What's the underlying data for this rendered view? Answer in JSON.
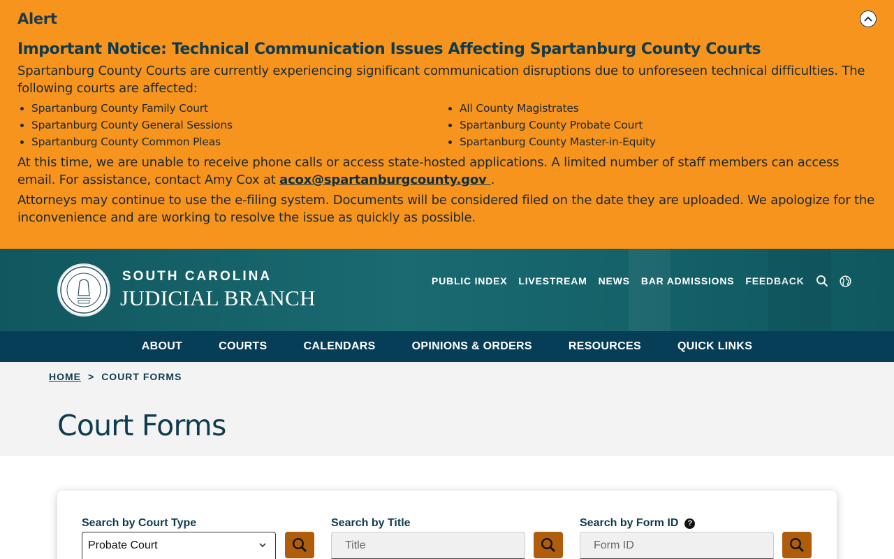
{
  "alert": {
    "title": "Alert",
    "heading": "Important Notice: Technical Communication Issues Affecting Spartanburg County Courts",
    "intro": "Spartanburg County Courts are currently experiencing significant communication disruptions due to unforeseen technical difficulties. The following courts are affected:",
    "courts_left": [
      "Spartanburg County Family Court",
      "Spartanburg County General Sessions",
      "Spartanburg County Common Pleas"
    ],
    "courts_right": [
      "All County Magistrates",
      "Spartanburg County Probate Court",
      "Spartanburg County Master-in-Equity"
    ],
    "para2_prefix": "At this time, we are unable to receive phone calls or access state-hosted applications. A limited number of staff members can access email. For assistance, contact Amy Cox at ",
    "contact_email": "acox@spartanburgcounty.gov ",
    "para2_suffix": ".",
    "para3": "Attorneys may continue to use the e-filing system. Documents will be considered filed on the date they are uploaded. We apologize for the inconvenience and are working to resolve the issue as quickly as possible."
  },
  "header": {
    "brand_top": "SOUTH CAROLINA",
    "brand_bottom": "JUDICIAL BRANCH",
    "utility_links": [
      "PUBLIC INDEX",
      "LIVESTREAM",
      "NEWS",
      "BAR ADMISSIONS",
      "FEEDBACK"
    ],
    "icons": [
      "search-icon",
      "globe-icon"
    ]
  },
  "main_nav": [
    "ABOUT",
    "COURTS",
    "CALENDARS",
    "OPINIONS & ORDERS",
    "RESOURCES",
    "QUICK LINKS"
  ],
  "breadcrumb": {
    "home": "HOME",
    "separator": ">",
    "current": "COURT FORMS"
  },
  "page_title": "Court Forms",
  "search": {
    "court_type_label": "Search by Court Type",
    "court_type_value": "Probate Court",
    "title_label": "Search by Title",
    "title_placeholder": "Title",
    "form_id_label": "Search by Form ID",
    "form_id_placeholder": "Form ID",
    "help_glyph": "?"
  },
  "colors": {
    "alert_bg": "#f7941d",
    "header_bg": "#11575f",
    "nav_bg": "#063e57",
    "button_bg": "#b05d0b",
    "title_color": "#0f3b4f"
  }
}
